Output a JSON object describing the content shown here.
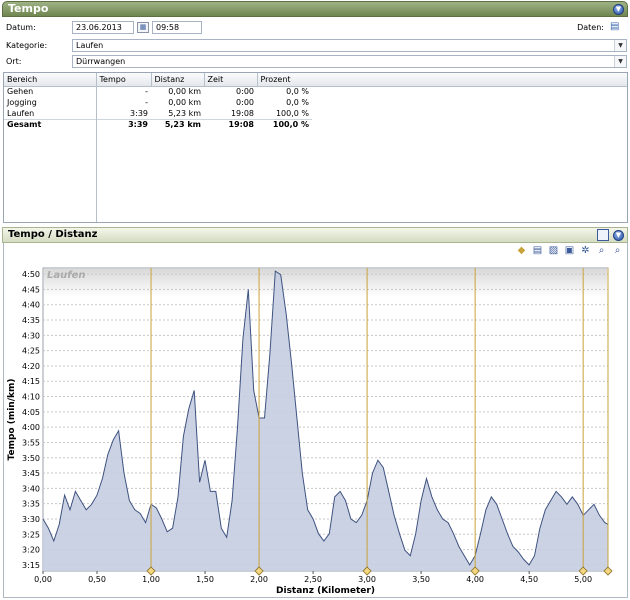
{
  "panel": {
    "title": "Tempo",
    "collapse_icon": "chevron-down-icon"
  },
  "form": {
    "date_label": "Datum:",
    "date_value": "23.06.2013",
    "time_value": "09:58",
    "data_label": "Daten:",
    "category_label": "Kategorie:",
    "category_value": "Laufen",
    "location_label": "Ort:",
    "location_value": "Dürrwangen"
  },
  "table": {
    "columns": [
      "Bereich",
      "Tempo",
      "Distanz",
      "Zeit",
      "Prozent"
    ],
    "rows": [
      [
        "Gehen",
        "-",
        "0,00 km",
        "0:00",
        "0,0 %"
      ],
      [
        "Jogging",
        "-",
        "0,00 km",
        "0:00",
        "0,0 %"
      ],
      [
        "Laufen",
        "3:39",
        "5,23 km",
        "19:08",
        "100,0 %"
      ],
      [
        "Gesamt",
        "3:39",
        "5,23 km",
        "19:08",
        "100,0 %"
      ]
    ]
  },
  "chart_panel": {
    "title": "Tempo / Distanz"
  },
  "toolbar_icons": [
    "marker-icon",
    "table-view-icon",
    "chart-view-icon",
    "save-icon",
    "settings-icon",
    "zoom-in-icon",
    "zoom-out-icon"
  ],
  "colors": {
    "fill": "#c5cde0",
    "line": "#3e5280",
    "marker": "#c8a23a",
    "header_green": "#7a8f5a"
  },
  "chart_data": {
    "type": "area",
    "title": "",
    "series_label": "Laufen",
    "xlabel": "Distanz (Kilometer)",
    "ylabel": "Tempo (min/km)",
    "xlim": [
      0,
      5.23
    ],
    "ylim": [
      3.25,
      4.85
    ],
    "y_unit_note": "pace in minutes (decimal minutes of mm:ss)",
    "x_ticks": [
      "0,00",
      "0,50",
      "1,00",
      "1,50",
      "2,00",
      "2,50",
      "3,00",
      "3,50",
      "4,00",
      "4,50",
      "5,00"
    ],
    "y_ticks": [
      "3:15",
      "3:20",
      "3:25",
      "3:30",
      "3:35",
      "3:40",
      "3:45",
      "3:50",
      "3:55",
      "4:00",
      "4:05",
      "4:10",
      "4:15",
      "4:20",
      "4:25",
      "4:30",
      "4:35",
      "4:40",
      "4:45",
      "4:50"
    ],
    "km_markers": [
      1.0,
      2.0,
      3.0,
      4.0,
      5.0,
      5.23
    ],
    "x": [
      0.0,
      0.05,
      0.1,
      0.15,
      0.2,
      0.25,
      0.3,
      0.35,
      0.4,
      0.45,
      0.5,
      0.55,
      0.6,
      0.65,
      0.7,
      0.75,
      0.8,
      0.85,
      0.9,
      0.95,
      1.0,
      1.05,
      1.1,
      1.15,
      1.2,
      1.25,
      1.3,
      1.35,
      1.4,
      1.45,
      1.5,
      1.55,
      1.6,
      1.65,
      1.7,
      1.75,
      1.8,
      1.85,
      1.9,
      1.95,
      2.0,
      2.05,
      2.1,
      2.15,
      2.2,
      2.25,
      2.3,
      2.35,
      2.4,
      2.45,
      2.5,
      2.55,
      2.6,
      2.65,
      2.7,
      2.75,
      2.8,
      2.85,
      2.9,
      2.95,
      3.0,
      3.05,
      3.1,
      3.15,
      3.2,
      3.25,
      3.3,
      3.35,
      3.4,
      3.45,
      3.5,
      3.55,
      3.6,
      3.65,
      3.7,
      3.75,
      3.8,
      3.85,
      3.9,
      3.95,
      4.0,
      4.05,
      4.1,
      4.15,
      4.2,
      4.25,
      4.3,
      4.35,
      4.4,
      4.45,
      4.5,
      4.55,
      4.6,
      4.65,
      4.7,
      4.75,
      4.8,
      4.85,
      4.9,
      4.95,
      5.0,
      5.05,
      5.1,
      5.15,
      5.2,
      5.23
    ],
    "values": [
      3.5,
      3.45,
      3.38,
      3.47,
      3.63,
      3.55,
      3.65,
      3.6,
      3.55,
      3.58,
      3.63,
      3.72,
      3.85,
      3.93,
      3.98,
      3.75,
      3.6,
      3.55,
      3.53,
      3.48,
      3.58,
      3.56,
      3.5,
      3.43,
      3.45,
      3.62,
      3.95,
      4.1,
      4.2,
      3.7,
      3.82,
      3.65,
      3.65,
      3.45,
      3.4,
      3.6,
      4.0,
      4.48,
      4.75,
      4.2,
      4.05,
      4.05,
      4.4,
      4.85,
      4.83,
      4.62,
      4.35,
      4.05,
      3.75,
      3.55,
      3.5,
      3.42,
      3.38,
      3.42,
      3.62,
      3.65,
      3.6,
      3.5,
      3.48,
      3.52,
      3.6,
      3.75,
      3.82,
      3.78,
      3.65,
      3.52,
      3.42,
      3.33,
      3.3,
      3.42,
      3.6,
      3.72,
      3.62,
      3.55,
      3.5,
      3.48,
      3.42,
      3.35,
      3.3,
      3.25,
      3.3,
      3.42,
      3.55,
      3.62,
      3.58,
      3.5,
      3.42,
      3.35,
      3.32,
      3.28,
      3.25,
      3.3,
      3.45,
      3.55,
      3.6,
      3.65,
      3.62,
      3.58,
      3.62,
      3.58,
      3.52,
      3.55,
      3.58,
      3.52,
      3.48,
      3.47
    ]
  }
}
